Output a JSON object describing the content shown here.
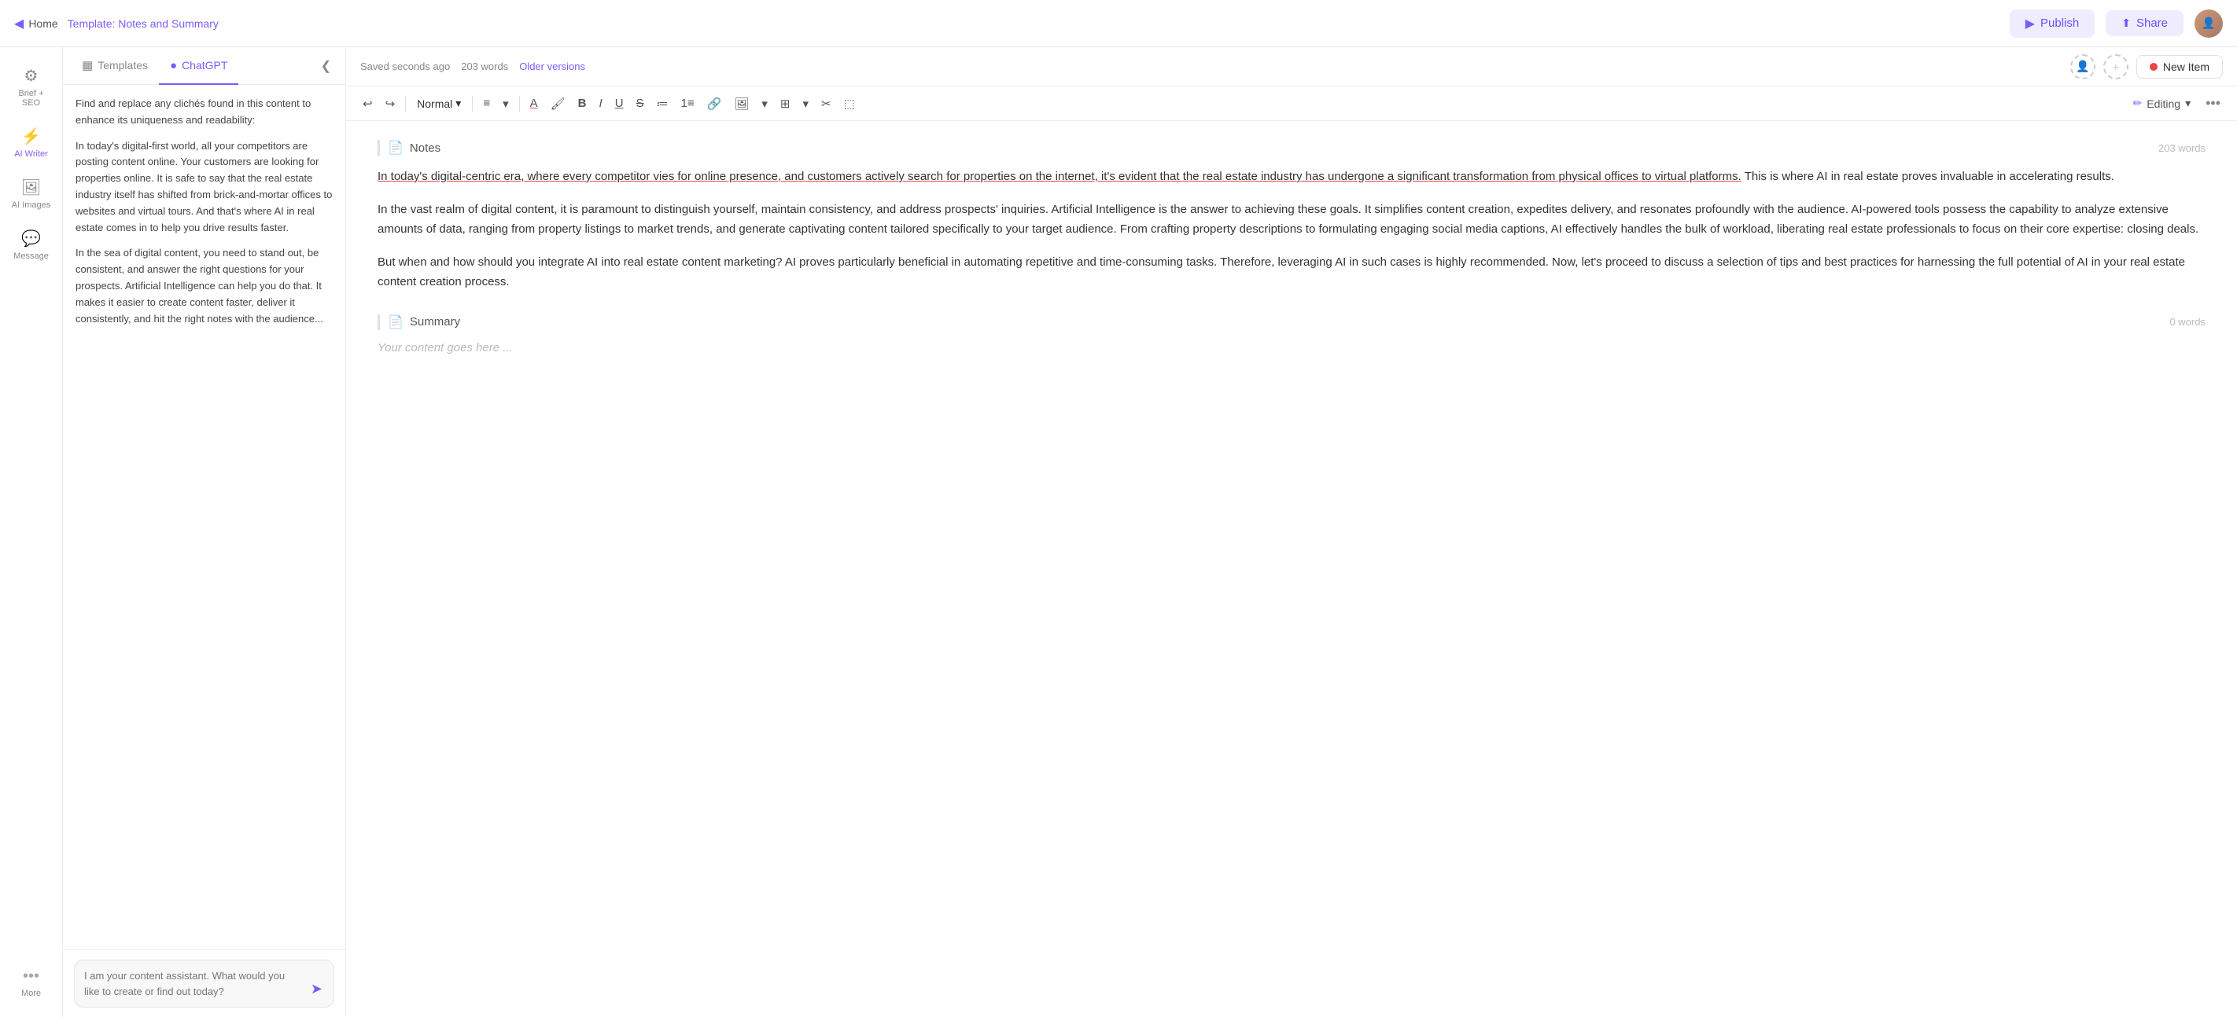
{
  "topbar": {
    "home_label": "Home",
    "breadcrumb_prefix": "Template: ",
    "breadcrumb_name": "Notes and Summary",
    "publish_label": "Publish",
    "share_label": "Share"
  },
  "sidebar": {
    "items": [
      {
        "id": "brief-seo",
        "icon": "⚙",
        "label": "Brief + SEO"
      },
      {
        "id": "ai-writer",
        "icon": "⚡",
        "label": "AI Writer"
      },
      {
        "id": "ai-images",
        "icon": "🖼",
        "label": "AI Images"
      },
      {
        "id": "message",
        "icon": "💬",
        "label": "Message"
      }
    ],
    "more_label": "More"
  },
  "panel": {
    "tabs": [
      {
        "id": "templates",
        "icon": "▦",
        "label": "Templates"
      },
      {
        "id": "chatgpt",
        "icon": "●",
        "label": "ChatGPT"
      }
    ],
    "active_tab": "chatgpt",
    "content_paragraphs": [
      "Find and replace any clichés found in this content to enhance its uniqueness and readability:",
      "In today's digital-first world, all your competitors are posting content online. Your customers are looking for properties online. It is safe to say that the real estate industry itself has shifted from brick-and-mortar offices to websites and virtual tours. And that's where AI in real estate comes in to help you drive results faster.",
      "In the sea of digital content, you need to stand out, be consistent, and answer the right questions for your prospects. Artificial Intelligence can help you do that. It makes it easier to create content faster, deliver it consistently, and hit the right notes with the audience..."
    ],
    "chat_placeholder": "I am your content assistant. What would you like to create or find out today?"
  },
  "editor": {
    "saved_text": "Saved seconds ago",
    "word_count": "203 words",
    "older_versions": "Older versions",
    "new_item_label": "New Item",
    "toolbar": {
      "style_label": "Normal",
      "editing_label": "Editing"
    },
    "sections": [
      {
        "id": "notes",
        "icon": "📄",
        "title": "Notes",
        "word_count": "203 words",
        "paragraphs": [
          "In today's digital-centric era, where every competitor vies for online presence, and customers actively search for properties on the internet, it's evident that the real estate industry has undergone a significant transformation from physical offices to virtual platforms. This is where AI in real estate proves invaluable in accelerating results.",
          "In the vast realm of digital content, it is paramount to distinguish yourself, maintain consistency, and address prospects' inquiries. Artificial Intelligence is the answer to achieving these goals. It simplifies content creation, expedites delivery, and resonates profoundly with the audience. AI-powered tools possess the capability to analyze extensive amounts of data, ranging from property listings to market trends, and generate captivating content tailored specifically to your target audience. From crafting property descriptions to formulating engaging social media captions, AI effectively handles the bulk of workload, liberating real estate professionals to focus on their core expertise: closing deals.",
          "But when and how should you integrate AI into real estate content marketing? AI proves particularly beneficial in automating repetitive and time-consuming tasks. Therefore, leveraging AI in such cases is highly recommended. Now, let's proceed to discuss a selection of tips and best practices for harnessing the full potential of AI in your real estate content creation process."
        ]
      },
      {
        "id": "summary",
        "icon": "📄",
        "title": "Summary",
        "word_count": "0 words",
        "placeholder": "Your content goes here ..."
      }
    ]
  }
}
